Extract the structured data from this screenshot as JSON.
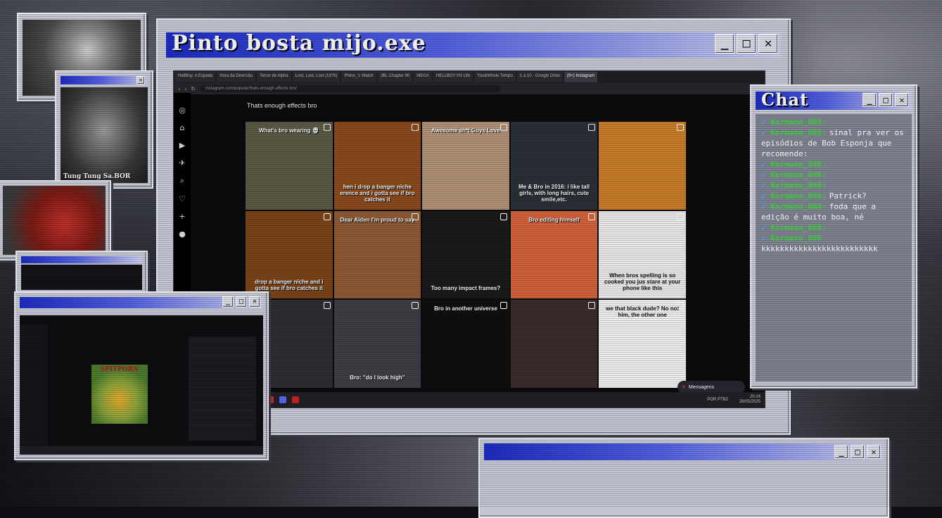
{
  "main_window": {
    "title": "Pinto bosta mijo.exe"
  },
  "chat_window": {
    "title": "Chat",
    "lines": [
      {
        "user": "Kormano_008:",
        "text": ""
      },
      {
        "user": "Kormano_008:",
        "text": "sinal pra ver os episódios de Bob Esponja que recomende:"
      },
      {
        "user": "Kormano_008:",
        "text": ""
      },
      {
        "user": "Kormano_008:",
        "text": ""
      },
      {
        "user": "Kormano_008:",
        "text": ""
      },
      {
        "user": "Kormano_008:",
        "text": "Patrick?"
      },
      {
        "user": "Kormano_008:",
        "text": "foda que a edição é muito boa, né"
      },
      {
        "user": "Kormano_008:",
        "text": ""
      },
      {
        "user": "Kormano_008",
        "text": ""
      }
    ],
    "last_line": "kkkkkkkkkkkkkkkkkkkkkkkkk"
  },
  "window_buttons": {
    "minimize": "_",
    "maximize": "□",
    "close": "✕"
  },
  "browser": {
    "tabs": [
      "HellBoy: A Espada",
      "Hora da Diversão",
      "Terror de Alpha",
      "Lost, Lost, Lost (1976)",
      "Phine_'s Watch",
      "JBL Chapter 90",
      "MEGA",
      "HELLBOY H3 Life",
      "You&Whole Tempo",
      "1 a 10 - Google Drive",
      "(9+) Instagram"
    ],
    "url": "instagram.com/popular/thats-enough-effects-bro/",
    "feed_title": "Thats enough effects bro"
  },
  "tiles": [
    {
      "caption": "What's bro wearing 💀",
      "bg": "#5b5a45"
    },
    {
      "caption": "hen i drop a banger niche erence and i gotta see if bro catches it",
      "bg": "#8a4a1c"
    },
    {
      "caption": "Awesome sh*t Guys Love",
      "bg": "#b09178"
    },
    {
      "caption": "Me & Bro in 2016: i like tall girls, with long hairs, cute smile,etc.",
      "bg": "#2b3038"
    },
    {
      "caption": "",
      "bg": "#c87d28"
    },
    {
      "caption": "drop a banger niche and i gotta see if bro catches it",
      "bg": "#7a4418"
    },
    {
      "caption": "Dear Aiden I'm proud to say",
      "bg": "#8f5a36"
    },
    {
      "caption": "Too many impact frames?",
      "bg": "#1a1a1a"
    },
    {
      "caption": "Bro editing himself",
      "bg": "#d2623b"
    },
    {
      "caption": "When bros spelling is so cooked you jus stare at your phone like this",
      "bg": "#e8e8e8"
    },
    {
      "caption": "",
      "bg": "#2f2d33"
    },
    {
      "caption": "Bro: \"do I look high\"",
      "bg": "#3d3d44"
    },
    {
      "caption": "Bro in another universe",
      "bg": "#0f0f10"
    },
    {
      "caption": "",
      "bg": "#3a2c2c"
    },
    {
      "caption": "we that black dude? No not him, the other one",
      "bg": "#ededed"
    }
  ],
  "webcam_captions": {
    "tung": "Tung Tung Sa.BOR"
  },
  "player": {
    "album_text": "SPITPORN"
  },
  "messages_button": {
    "label": "Mensagens"
  },
  "tray": {
    "lang": "POR PTB2",
    "time": "20:24",
    "date": "26/05/2025"
  }
}
